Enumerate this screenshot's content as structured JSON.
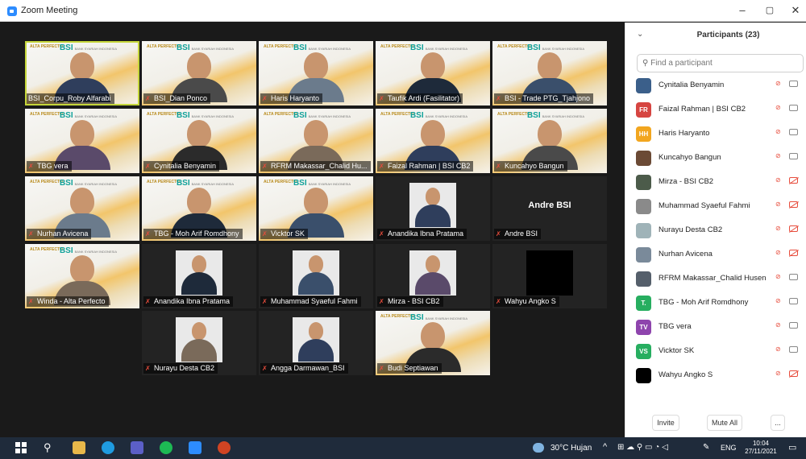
{
  "window": {
    "title": "Zoom Meeting",
    "min": "–",
    "max": "▢",
    "close": "✕"
  },
  "brand": {
    "left": "ALTA PERFECTO",
    "right": "BSI",
    "right_small": "BANK SYARIAH INDONESIA"
  },
  "tiles": [
    {
      "label": "BSI_Corpu_Roby Alfarabi",
      "muted": false,
      "style": "brand"
    },
    {
      "label": "BSI_Dian Ponco",
      "muted": true,
      "style": "brand"
    },
    {
      "label": "Haris Haryanto",
      "muted": true,
      "style": "brand"
    },
    {
      "label": "Taufik Ardi (Fasilitator)",
      "muted": true,
      "style": "brand"
    },
    {
      "label": "BSI - Trade PTG_Tjahjono",
      "muted": true,
      "style": "brand"
    },
    {
      "label": "TBG vera",
      "muted": true,
      "style": "brand"
    },
    {
      "label": "Cynitalia Benyamin",
      "muted": true,
      "style": "brand"
    },
    {
      "label": "RFRM Makassar_Chalid Hu...",
      "muted": true,
      "style": "brand"
    },
    {
      "label": "Faizal Rahman | BSI CB2",
      "muted": true,
      "style": "brand"
    },
    {
      "label": "Kuncahyo Bangun",
      "muted": true,
      "style": "brand"
    },
    {
      "label": "Nurhan Avicena",
      "muted": true,
      "style": "brand"
    },
    {
      "label": "TBG - Moh Arif Romdhony",
      "muted": true,
      "style": "brand"
    },
    {
      "label": "Vicktor SK",
      "muted": true,
      "style": "brand"
    },
    {
      "label": "Anandika Ibna Pratama",
      "muted": true,
      "style": "photo"
    },
    {
      "label": "Andre BSI",
      "muted": true,
      "style": "name",
      "center_name": "Andre BSI"
    },
    {
      "label": "Winda - Alta Perfecto",
      "muted": true,
      "style": "brand"
    },
    {
      "label": "Anandika Ibna Pratama",
      "muted": true,
      "style": "photo"
    },
    {
      "label": "Muhammad Syaeful Fahmi",
      "muted": true,
      "style": "photo"
    },
    {
      "label": "Mirza - BSI CB2",
      "muted": true,
      "style": "photo"
    },
    {
      "label": "Wahyu Angko S",
      "muted": true,
      "style": "black"
    },
    {
      "label": "Nurayu Desta CB2",
      "muted": true,
      "style": "photo"
    },
    {
      "label": "Angga Darmawan_BSI",
      "muted": true,
      "style": "photo"
    },
    {
      "label": "Budi Septiawan",
      "muted": true,
      "style": "brand"
    }
  ],
  "participants_panel": {
    "title": "Participants (23)",
    "search_placeholder": "Find a participant",
    "items": [
      {
        "name": "Cynitalia Benyamin",
        "initials": "",
        "color": "#3b5f8a",
        "cam_off": false
      },
      {
        "name": "Faizal Rahman | BSI CB2",
        "initials": "FR",
        "color": "#d64541",
        "cam_off": false
      },
      {
        "name": "Haris Haryanto",
        "initials": "HH",
        "color": "#f2a61f",
        "cam_off": false
      },
      {
        "name": "Kuncahyo Bangun",
        "initials": "",
        "color": "#6b4a35",
        "cam_off": false
      },
      {
        "name": "Mirza - BSI CB2",
        "initials": "",
        "color": "#4c5b4a",
        "cam_off": true
      },
      {
        "name": "Muhammad Syaeful Fahmi",
        "initials": "",
        "color": "#8a8a8a",
        "cam_off": true
      },
      {
        "name": "Nurayu Desta CB2",
        "initials": "",
        "color": "#9fb3b8",
        "cam_off": true
      },
      {
        "name": "Nurhan Avicena",
        "initials": "",
        "color": "#7a8a9a",
        "cam_off": true
      },
      {
        "name": "RFRM Makassar_Chalid Husen",
        "initials": "",
        "color": "#555f6b",
        "cam_off": false
      },
      {
        "name": "TBG - Moh Arif Romdhony",
        "initials": "T.",
        "color": "#27ae60",
        "cam_off": false
      },
      {
        "name": "TBG vera",
        "initials": "TV",
        "color": "#8e44ad",
        "cam_off": false
      },
      {
        "name": "Vicktor SK",
        "initials": "VS",
        "color": "#27ae60",
        "cam_off": false
      },
      {
        "name": "Wahyu Angko S",
        "initials": "",
        "color": "#000000",
        "cam_off": true
      }
    ],
    "invite": "Invite",
    "mute_all": "Mute All",
    "more": "..."
  },
  "taskbar": {
    "weather": "30°C  Hujan",
    "lang": "ENG",
    "time": "10:04",
    "date": "27/11/2021"
  }
}
